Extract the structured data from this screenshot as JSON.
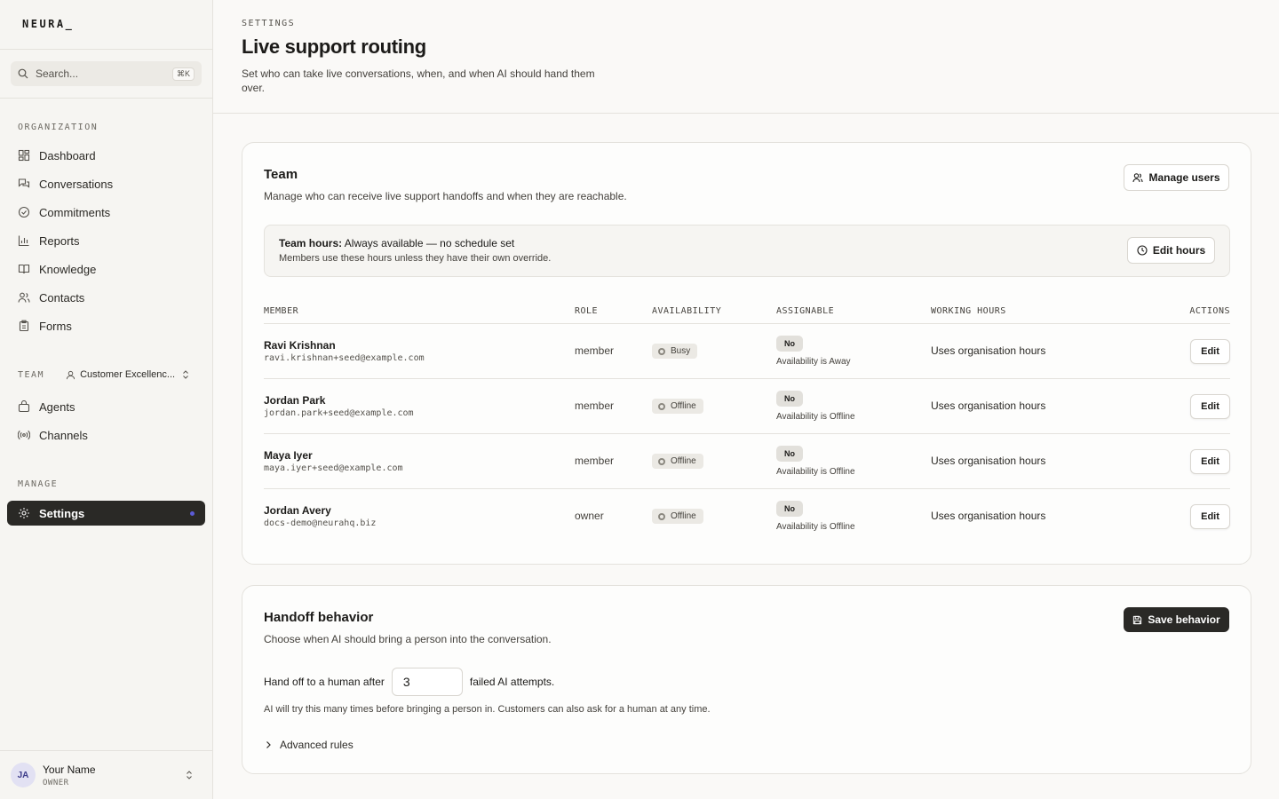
{
  "app": {
    "logo": "NEURA_"
  },
  "search": {
    "placeholder": "Search...",
    "shortcut": "⌘K"
  },
  "sidebar": {
    "org_label": "ORGANIZATION",
    "org_items": [
      "Dashboard",
      "Conversations",
      "Commitments",
      "Reports",
      "Knowledge",
      "Contacts",
      "Forms"
    ],
    "team_label": "TEAM",
    "team_name": "Customer Excellenc...",
    "team_items": [
      "Agents",
      "Channels"
    ],
    "manage_label": "MANAGE",
    "manage_items": [
      "Settings"
    ]
  },
  "user": {
    "initials": "JA",
    "name": "Your Name",
    "role": "OWNER"
  },
  "header": {
    "eyebrow": "SETTINGS",
    "title": "Live support routing",
    "description": "Set who can take live conversations, when, and when AI should hand them over."
  },
  "team_card": {
    "title": "Team",
    "subtitle": "Manage who can receive live support handoffs and when they are reachable.",
    "manage_users_label": "Manage users",
    "hours_title": "Team hours:",
    "hours_value": "Always available — no schedule set",
    "hours_note": "Members use these hours unless they have their own override.",
    "edit_hours_label": "Edit hours",
    "columns": [
      "MEMBER",
      "ROLE",
      "AVAILABILITY",
      "ASSIGNABLE",
      "WORKING HOURS",
      "ACTIONS"
    ],
    "members": [
      {
        "name": "Ravi Krishnan",
        "email": "ravi.krishnan+seed@example.com",
        "role": "member",
        "availability": "Busy",
        "assignable": "No",
        "assign_note": "Availability is Away",
        "hours": "Uses organisation hours",
        "action": "Edit"
      },
      {
        "name": "Jordan Park",
        "email": "jordan.park+seed@example.com",
        "role": "member",
        "availability": "Offline",
        "assignable": "No",
        "assign_note": "Availability is Offline",
        "hours": "Uses organisation hours",
        "action": "Edit"
      },
      {
        "name": "Maya Iyer",
        "email": "maya.iyer+seed@example.com",
        "role": "member",
        "availability": "Offline",
        "assignable": "No",
        "assign_note": "Availability is Offline",
        "hours": "Uses organisation hours",
        "action": "Edit"
      },
      {
        "name": "Jordan Avery",
        "email": "docs-demo@neurahq.biz",
        "role": "owner",
        "availability": "Offline",
        "assignable": "No",
        "assign_note": "Availability is Offline",
        "hours": "Uses organisation hours",
        "action": "Edit"
      }
    ]
  },
  "handoff_card": {
    "title": "Handoff behavior",
    "subtitle": "Choose when AI should bring a person into the conversation.",
    "save_label": "Save behavior",
    "prefix": "Hand off to a human after",
    "attempts_value": "3",
    "suffix": "failed AI attempts.",
    "help": "AI will try this many times before bringing a person in. Customers can also ask for a human at any time.",
    "advanced_label": "Advanced rules"
  },
  "colors": {
    "accent_dark": "#2a2926",
    "active_dot": "#5b5bd6",
    "background": "#faf9f7"
  }
}
